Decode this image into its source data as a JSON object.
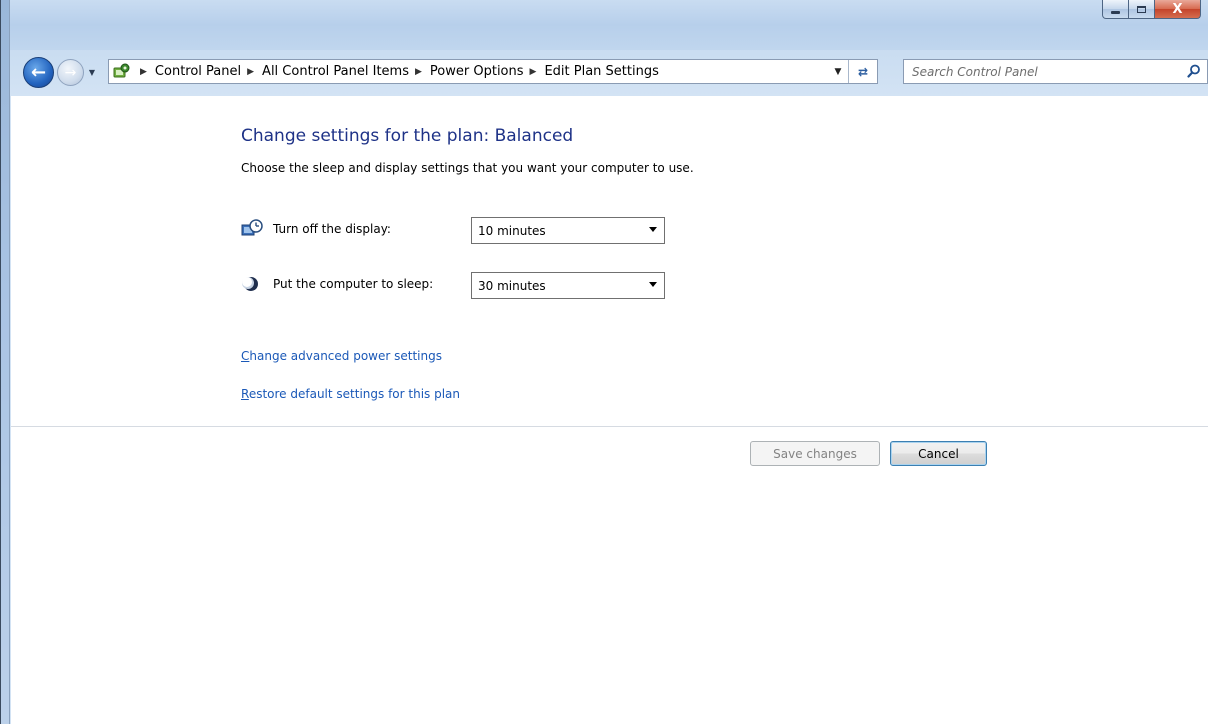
{
  "window": {
    "caption_buttons": [
      "minimize",
      "maximize",
      "close"
    ],
    "close_glyph": "X"
  },
  "navigation": {
    "back_icon": "arrow-left-icon",
    "forward_icon": "arrow-right-icon",
    "breadcrumbs": [
      "Control Panel",
      "All Control Panel Items",
      "Power Options",
      "Edit Plan Settings"
    ],
    "refresh_icon": "refresh-icon"
  },
  "search": {
    "placeholder": "Search Control Panel"
  },
  "page": {
    "title": "Change settings for the plan: Balanced",
    "subtitle": "Choose the sleep and display settings that you want your computer to use.",
    "settings": [
      {
        "label": "Turn off the display:",
        "value": "10 minutes",
        "icon": "display-timer-icon"
      },
      {
        "label": "Put the computer to sleep:",
        "value": "30 minutes",
        "icon": "moon-sleep-icon"
      }
    ],
    "links": [
      {
        "accesskey": "C",
        "rest": "hange advanced power settings"
      },
      {
        "accesskey": "R",
        "rest": "estore default settings for this plan"
      }
    ]
  },
  "buttons": {
    "save_label": "Save changes",
    "cancel_label": "Cancel"
  },
  "colors": {
    "heading": "#1e3287",
    "link": "#1a58b7"
  }
}
